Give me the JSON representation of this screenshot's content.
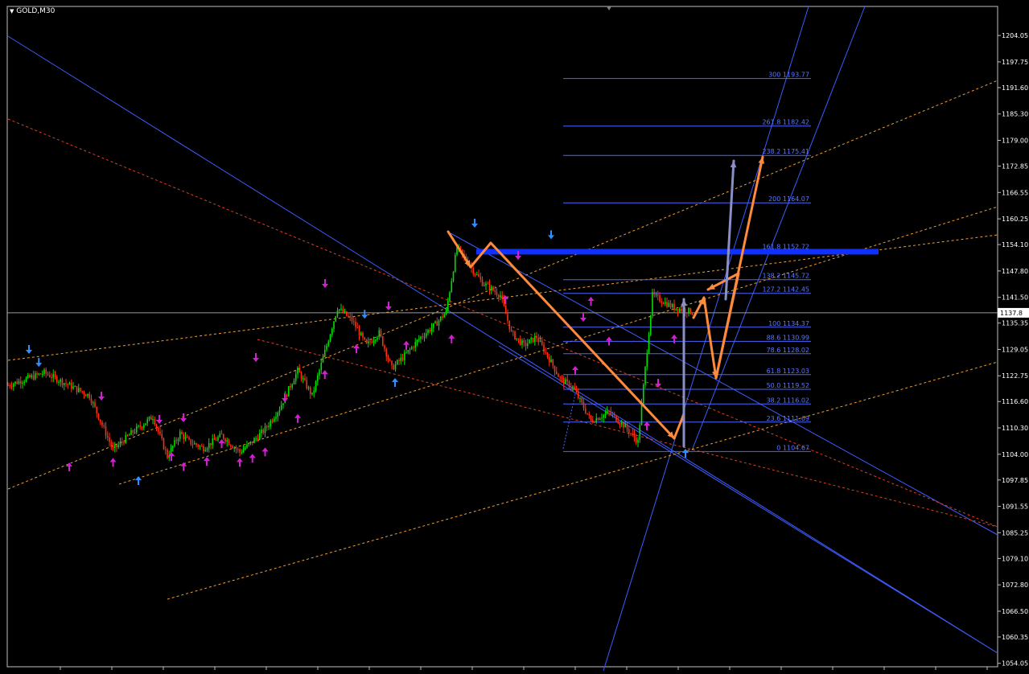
{
  "symbol": "GOLD,M30",
  "colors": {
    "background": "#000000",
    "frame": "#c0c0c0",
    "bull": "#00e000",
    "bear": "#ff3010",
    "fib": "#4a66ff",
    "fib_text": "#5a78ff",
    "channel_blue": "#3d5cff",
    "dotted_orange": "#f0a030",
    "dotted_red": "#e04020",
    "arrow_orange": "#ff8a3c",
    "arrow_gray": "#8a8fc8",
    "fractal_blue": "#2e8fff",
    "fractal_magenta": "#d020d0",
    "resistance": "#1030ff",
    "current_price_line": "#9a9a9a"
  },
  "chart_data": {
    "type": "line",
    "title": "GOLD,M30",
    "ylim": [
      1054.0,
      1206.0
    ],
    "y_ticks": [
      "1204.05",
      "1197.75",
      "1191.60",
      "1185.30",
      "1179.00",
      "1172.85",
      "1166.55",
      "1160.25",
      "1154.10",
      "1147.80",
      "1141.50",
      "1135.35",
      "1129.05",
      "1122.75",
      "1116.60",
      "1110.30",
      "1104.00",
      "1097.85",
      "1091.55",
      "1085.25",
      "1079.10",
      "1072.80",
      "1066.50",
      "1060.35",
      "1054.05"
    ],
    "current_price": "1137.8",
    "price_path": {
      "bar_index": [
        0,
        20,
        45,
        58,
        68,
        80,
        88,
        95,
        100,
        108,
        118,
        128,
        135,
        142,
        150,
        160,
        168,
        175,
        182,
        190,
        198,
        205,
        212,
        220,
        228,
        236,
        242,
        248,
        256,
        262,
        272,
        278,
        285,
        292,
        300,
        305,
        312,
        322,
        332,
        340,
        348,
        356,
        368,
        378
      ],
      "price": [
        1120.5,
        1123.5,
        1118.0,
        1105.0,
        1109.0,
        1113.0,
        1103.5,
        1109.0,
        1107.0,
        1105.5,
        1108.5,
        1104.5,
        1107.0,
        1110.0,
        1115.0,
        1124.0,
        1118.0,
        1128.5,
        1139.0,
        1136.0,
        1130.0,
        1133.0,
        1124.5,
        1128.0,
        1132.0,
        1135.0,
        1138.0,
        1153.5,
        1148.5,
        1145.0,
        1142.0,
        1133.0,
        1130.0,
        1132.0,
        1126.0,
        1122.0,
        1120.0,
        1112.0,
        1114.0,
        1111.0,
        1107.0,
        1142.0,
        1139.0,
        1138.0
      ]
    },
    "fib_levels": [
      {
        "pct": "300",
        "price": 1193.77,
        "label": "300 1193.77"
      },
      {
        "pct": "261.8",
        "price": 1182.42,
        "label": "261.8 1182.42"
      },
      {
        "pct": "238.2",
        "price": 1175.41,
        "label": "238.2 1175.41"
      },
      {
        "pct": "200",
        "price": 1164.07,
        "label": "200 1164.07"
      },
      {
        "pct": "161.8",
        "price": 1152.72,
        "label": "161.8 1152.72"
      },
      {
        "pct": "138.2",
        "price": 1145.72,
        "label": "138.2 1145.72"
      },
      {
        "pct": "127.2",
        "price": 1142.45,
        "label": "127.2 1142.45"
      },
      {
        "pct": "100",
        "price": 1134.37,
        "label": "100 1134.37"
      },
      {
        "pct": "88.6",
        "price": 1130.99,
        "label": "88.6 1130.99"
      },
      {
        "pct": "78.6",
        "price": 1128.02,
        "label": "78.6 1128.02"
      },
      {
        "pct": "61.8",
        "price": 1123.03,
        "label": "61.8 1123.03"
      },
      {
        "pct": "50.0",
        "price": 1119.52,
        "label": "50.0 1119.52"
      },
      {
        "pct": "38.2",
        "price": 1116.02,
        "label": "38.2 1116.02"
      },
      {
        "pct": "23.6",
        "price": 1111.69,
        "label": "23.6 1111.69"
      },
      {
        "pct": "0",
        "price": 1104.67,
        "label": "0 1104.67"
      }
    ],
    "resistance_price": 1152.5,
    "fractals_up": [
      {
        "bar": 17,
        "price": 1124.5
      },
      {
        "bar": 197,
        "price": 1136.0
      },
      {
        "bar": 300,
        "price": 1155.0
      }
    ],
    "fractals_down": [
      {
        "bar": 58,
        "price": 1103.5
      },
      {
        "bar": 97,
        "price": 1102.5
      },
      {
        "bar": 118,
        "price": 1108.0
      },
      {
        "bar": 128,
        "price": 1103.5
      },
      {
        "bar": 135,
        "price": 1104.5
      },
      {
        "bar": 142,
        "price": 1106.0
      },
      {
        "bar": 160,
        "price": 1114.0
      },
      {
        "bar": 175,
        "price": 1124.5
      },
      {
        "bar": 220,
        "price": 1131.5
      },
      {
        "bar": 245,
        "price": 1133.0
      },
      {
        "bar": 322,
        "price": 1142.0
      },
      {
        "bar": 332,
        "price": 1132.5
      },
      {
        "bar": 368,
        "price": 1133.0
      }
    ],
    "grid": false
  }
}
